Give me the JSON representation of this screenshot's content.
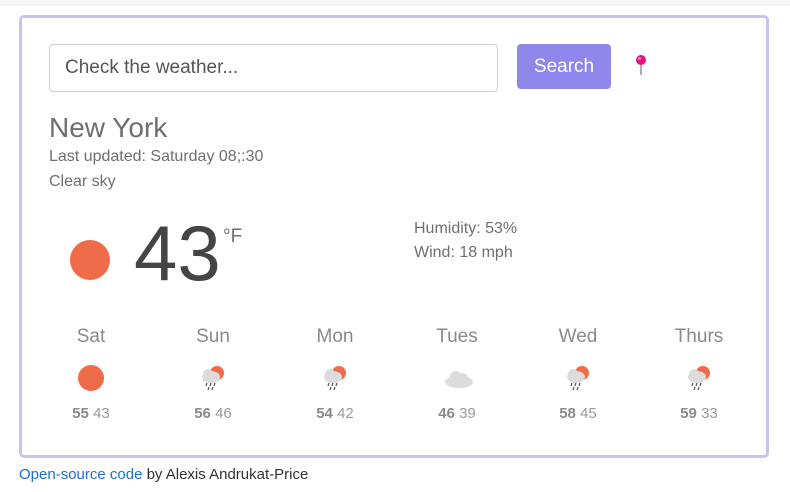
{
  "search": {
    "placeholder": "Check the weather...",
    "button_label": "Search"
  },
  "current": {
    "city": "New York",
    "last_updated": "Last updated: Saturday 08;:30",
    "description": "Clear sky",
    "temperature": "43",
    "unit": "°F",
    "humidity": "Humidity: 53%",
    "wind": "Wind: 18 mph",
    "icon": "clear-sky-sun-icon"
  },
  "forecast": [
    {
      "day": "Sat",
      "high": "55",
      "low": "43",
      "icon": "sun-icon"
    },
    {
      "day": "Sun",
      "high": "56",
      "low": "46",
      "icon": "rain-sun-icon"
    },
    {
      "day": "Mon",
      "high": "54",
      "low": "42",
      "icon": "rain-sun-icon"
    },
    {
      "day": "Tues",
      "high": "46",
      "low": "39",
      "icon": "cloud-icon"
    },
    {
      "day": "Wed",
      "high": "58",
      "low": "45",
      "icon": "rain-sun-icon"
    },
    {
      "day": "Thurs",
      "high": "59",
      "low": "33",
      "icon": "rain-sun-icon"
    }
  ],
  "footer": {
    "link_text": "Open-source code",
    "suffix": " by Alexis Andrukat-Price"
  },
  "colors": {
    "accent": "#8f87ec",
    "card_border": "#c9c4ef",
    "sun": "#ef6c4a",
    "pin": "#e6127d",
    "link": "#1a6fd1"
  }
}
